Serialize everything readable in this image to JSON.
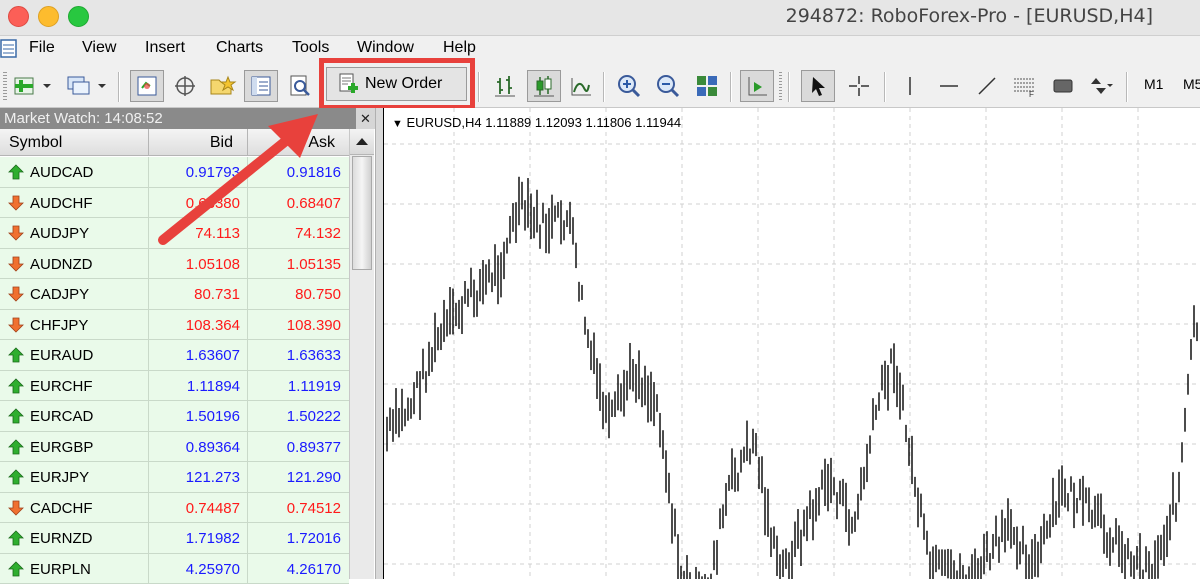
{
  "window": {
    "title": "294872: RoboForex-Pro - [EURUSD,H4]"
  },
  "menu": [
    "File",
    "View",
    "Insert",
    "Charts",
    "Tools",
    "Window",
    "Help"
  ],
  "toolbar": {
    "new_order_label": "New Order",
    "timeframes": [
      "M1",
      "M5"
    ]
  },
  "market_watch": {
    "title": "Market Watch: 14:08:52",
    "columns": {
      "symbol": "Symbol",
      "bid": "Bid",
      "ask": "Ask"
    },
    "rows": [
      {
        "symbol": "AUDCAD",
        "bid": "0.91793",
        "ask": "0.91816",
        "dir": "up",
        "color": "#1a1aff"
      },
      {
        "symbol": "AUDCHF",
        "bid": "0.68380",
        "ask": "0.68407",
        "dir": "down",
        "color": "#ff1a1a"
      },
      {
        "symbol": "AUDJPY",
        "bid": "74.113",
        "ask": "74.132",
        "dir": "down",
        "color": "#ff1a1a"
      },
      {
        "symbol": "AUDNZD",
        "bid": "1.05108",
        "ask": "1.05135",
        "dir": "down",
        "color": "#ff1a1a"
      },
      {
        "symbol": "CADJPY",
        "bid": "80.731",
        "ask": "80.750",
        "dir": "down",
        "color": "#ff1a1a"
      },
      {
        "symbol": "CHFJPY",
        "bid": "108.364",
        "ask": "108.390",
        "dir": "down",
        "color": "#ff1a1a"
      },
      {
        "symbol": "EURAUD",
        "bid": "1.63607",
        "ask": "1.63633",
        "dir": "up",
        "color": "#1a1aff"
      },
      {
        "symbol": "EURCHF",
        "bid": "1.11894",
        "ask": "1.11919",
        "dir": "up",
        "color": "#1a1aff"
      },
      {
        "symbol": "EURCAD",
        "bid": "1.50196",
        "ask": "1.50222",
        "dir": "up",
        "color": "#1a1aff"
      },
      {
        "symbol": "EURGBP",
        "bid": "0.89364",
        "ask": "0.89377",
        "dir": "up",
        "color": "#1a1aff"
      },
      {
        "symbol": "EURJPY",
        "bid": "121.273",
        "ask": "121.290",
        "dir": "up",
        "color": "#1a1aff"
      },
      {
        "symbol": "CADCHF",
        "bid": "0.74487",
        "ask": "0.74512",
        "dir": "down",
        "color": "#ff1a1a"
      },
      {
        "symbol": "EURNZD",
        "bid": "1.71982",
        "ask": "1.72016",
        "dir": "up",
        "color": "#1a1aff"
      },
      {
        "symbol": "EURPLN",
        "bid": "4.25970",
        "ask": "4.26170",
        "dir": "up",
        "color": "#1a1aff"
      }
    ]
  },
  "chart": {
    "info": "EURUSD,H4  1.11889 1.12093 1.11806 1.11944"
  },
  "colors": {
    "highlight": "#e8413c",
    "up": "#1a1aff",
    "down": "#ff1a1a",
    "row_bg": "#eafaea"
  }
}
